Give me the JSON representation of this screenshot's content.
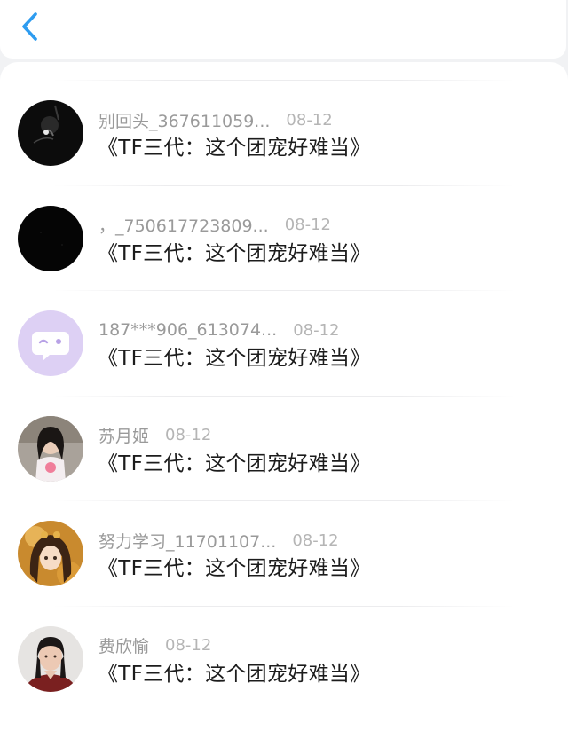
{
  "colors": {
    "accent": "#2d9cf0",
    "name_text": "#9a9a9a",
    "date_text": "#b5b5b5",
    "title_text": "#1c1c1c",
    "background": "#f1f2f4"
  },
  "header": {
    "back_icon": "chevron-left-icon"
  },
  "items": [
    {
      "name": "别回头_367611059...",
      "date": "08-12",
      "title": "《TF三代：这个团宠好难当》",
      "avatar": "dark-photo"
    },
    {
      "name": "，_750617723809...",
      "date": "08-12",
      "title": "《TF三代：这个团宠好难当》",
      "avatar": "black"
    },
    {
      "name": "187***906_613074...",
      "date": "08-12",
      "title": "《TF三代：这个团宠好难当》",
      "avatar": "default-chat-bubble"
    },
    {
      "name": "苏月姬",
      "date": "08-12",
      "title": "《TF三代：这个团宠好难当》",
      "avatar": "girl-photo"
    },
    {
      "name": "努力学习_11701107...",
      "date": "08-12",
      "title": "《TF三代：这个团宠好难当》",
      "avatar": "anime-girl"
    },
    {
      "name": "费欣愉",
      "date": "08-12",
      "title": "《TF三代：这个团宠好难当》",
      "avatar": "woman-photo"
    }
  ]
}
